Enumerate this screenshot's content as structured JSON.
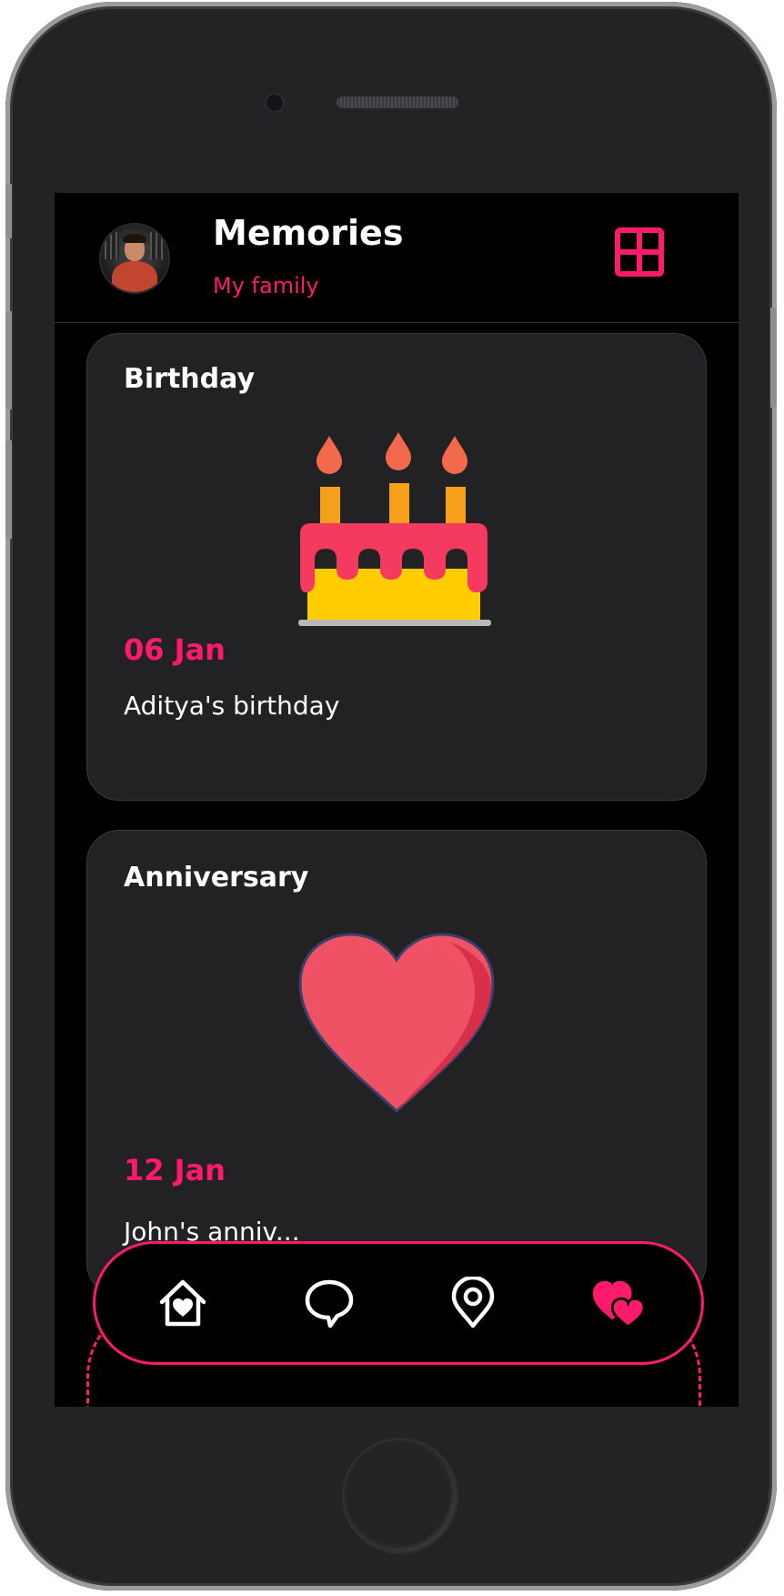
{
  "header": {
    "title": "Memories",
    "subtitle": "My family",
    "avatar_icon": "user-avatar",
    "menu_icon": "grid-icon"
  },
  "cards": [
    {
      "title": "Birthday",
      "illustration": "birthday-cake-icon",
      "date": "06 Jan",
      "description": "Aditya's birthday"
    },
    {
      "title": "Anniversary",
      "illustration": "heart-icon",
      "date": "12 Jan",
      "description": "John's anniv..."
    }
  ],
  "bottom_nav": {
    "items": [
      {
        "icon": "home-heart-icon",
        "active": false
      },
      {
        "icon": "chat-bubble-icon",
        "active": false
      },
      {
        "icon": "location-pin-icon",
        "active": false
      },
      {
        "icon": "hearts-icon",
        "active": true
      }
    ]
  },
  "colors": {
    "accent": "#ff1a6b",
    "background": "#000000",
    "card": "#222224",
    "text": "#ffffff"
  }
}
